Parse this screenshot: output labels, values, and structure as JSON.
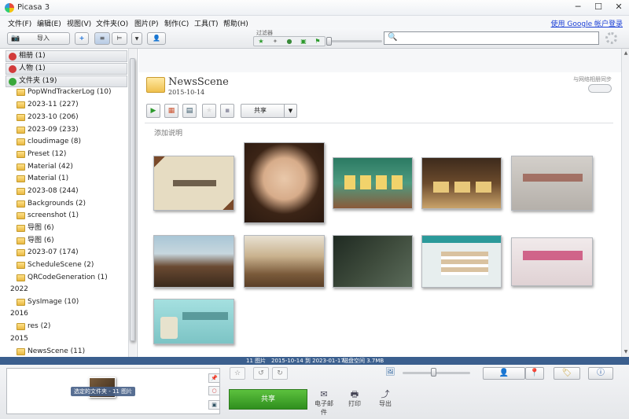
{
  "window": {
    "title": "Picasa 3",
    "min": "─",
    "max": "☐",
    "close": "✕"
  },
  "menu": {
    "items": [
      "文件(F)",
      "编辑(E)",
      "视图(V)",
      "文件夹(O)",
      "图片(P)",
      "制作(C)",
      "工具(T)",
      "帮助(H)"
    ],
    "signin": "使用 Google 帐户登录"
  },
  "toolbar": {
    "import_label": "导入",
    "filter_label": "过滤器",
    "search_placeholder": ""
  },
  "sidebar": {
    "sections": [
      {
        "label": "相册 (1)",
        "color": "#d23b3b"
      },
      {
        "label": "人物 (1)",
        "color": "#d23b3b"
      },
      {
        "label": "文件夹 (19)",
        "color": "#3aa83a"
      }
    ],
    "folders": [
      "PopWndTrackerLog (10)",
      "2023-11 (227)",
      "2023-10 (206)",
      "2023-09 (233)",
      "cloudimage (8)",
      "Preset (12)",
      "Material (42)",
      "Material (1)",
      "2023-08 (244)",
      "Backgrounds (2)",
      "screenshot (1)",
      "导图 (6)",
      "导图 (6)",
      "2023-07 (174)",
      "ScheduleScene (2)",
      "QRCodeGeneration (1)"
    ],
    "year_2022": "2022",
    "folder_2022": "SysImage (10)",
    "year_2016": "2016",
    "folder_2016": "res (2)",
    "year_2015": "2015",
    "folder_2015": "NewsScene (11)"
  },
  "album": {
    "title": "NewsScene",
    "date": "2015-10-14",
    "sync_label": "与网络相册同步",
    "share_label": "共享",
    "caption_hint": "添加说明"
  },
  "photos": [
    {
      "name": "certificate",
      "colors": [
        "#7a4a2a",
        "#d9cfb6"
      ]
    },
    {
      "name": "child",
      "colors": [
        "#4b3222",
        "#d8b79c"
      ]
    },
    {
      "name": "app-screen",
      "colors": [
        "#2b7a63",
        "#8a5a3a"
      ]
    },
    {
      "name": "game-screen",
      "colors": [
        "#3d2a1c",
        "#c9a36b"
      ]
    },
    {
      "name": "plaque",
      "colors": [
        "#bdb9b4",
        "#8a8580"
      ]
    },
    {
      "name": "library",
      "colors": [
        "#6a4a32",
        "#a9c6d6"
      ]
    },
    {
      "name": "classroom",
      "colors": [
        "#7a5a3a",
        "#c9b28e"
      ]
    },
    {
      "name": "dark-ui",
      "colors": [
        "#1f2a22",
        "#5b6b5a"
      ]
    },
    {
      "name": "web-page",
      "colors": [
        "#2b9a9a",
        "#e7eeee"
      ]
    },
    {
      "name": "reading-event",
      "colors": [
        "#e9dfe0",
        "#c7396b"
      ]
    },
    {
      "name": "reading-banner",
      "colors": [
        "#8fd3d3",
        "#4aa3a6"
      ]
    }
  ],
  "status": {
    "count": "11 图片",
    "range": "2015-10-14 到 2023-01-17",
    "disk": "磁盘空间 3.7MB"
  },
  "bottom": {
    "tray_label": "选定的文件夹 - 11 图片",
    "share_label": "共享",
    "email_label": "电子邮件",
    "print_label": "打印",
    "export_label": "导出"
  }
}
